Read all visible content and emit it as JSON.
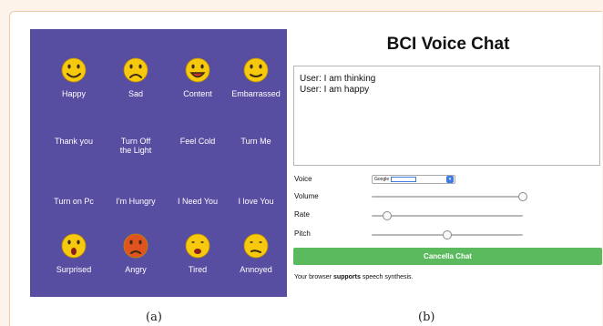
{
  "panel_a": {
    "background": "#574ea1",
    "cells": [
      {
        "label": "Happy",
        "icon": "happy-face-icon",
        "face": "happy",
        "color": "#f6c90e"
      },
      {
        "label": "Sad",
        "icon": "sad-face-icon",
        "face": "sad",
        "color": "#f6c90e"
      },
      {
        "label": "Content",
        "icon": "content-face-icon",
        "face": "content",
        "color": "#f6c90e"
      },
      {
        "label": "Embarrassed",
        "icon": "embarrassed-face-icon",
        "face": "embarrassed",
        "color": "#f6c90e"
      },
      {
        "label": "Thank you"
      },
      {
        "label": "Turn Off the Light"
      },
      {
        "label": "Feel Cold"
      },
      {
        "label": "Turn Me"
      },
      {
        "label": "Turn on Pc"
      },
      {
        "label": "I'm Hungry"
      },
      {
        "label": "I Need You"
      },
      {
        "label": "I love You"
      },
      {
        "label": "Surprised",
        "icon": "surprised-face-icon",
        "face": "surprised",
        "color": "#f6c90e"
      },
      {
        "label": "Angry",
        "icon": "angry-face-icon",
        "face": "angry",
        "color": "#e0531f"
      },
      {
        "label": "Tired",
        "icon": "tired-face-icon",
        "face": "tired",
        "color": "#f6c90e"
      },
      {
        "label": "Annoyed",
        "icon": "annoyed-face-icon",
        "face": "annoyed",
        "color": "#f6c90e"
      }
    ]
  },
  "captions": {
    "a": "(a)",
    "b": "(b)"
  },
  "chat": {
    "title": "BCI Voice Chat",
    "messages": [
      "User: I am thinking",
      "User: I am happy"
    ],
    "controls": {
      "voice_label": "Voice",
      "voice_value": "Google",
      "volume_label": "Volume",
      "volume": 1.0,
      "rate_label": "Rate",
      "rate": 0.1,
      "pitch_label": "Pitch",
      "pitch": 0.5
    },
    "cancel_label": "Cancella Chat",
    "status_prefix": "Your browser ",
    "status_bold": "supports",
    "status_suffix": " speech synthesis.",
    "button_color": "#5cba5e"
  }
}
